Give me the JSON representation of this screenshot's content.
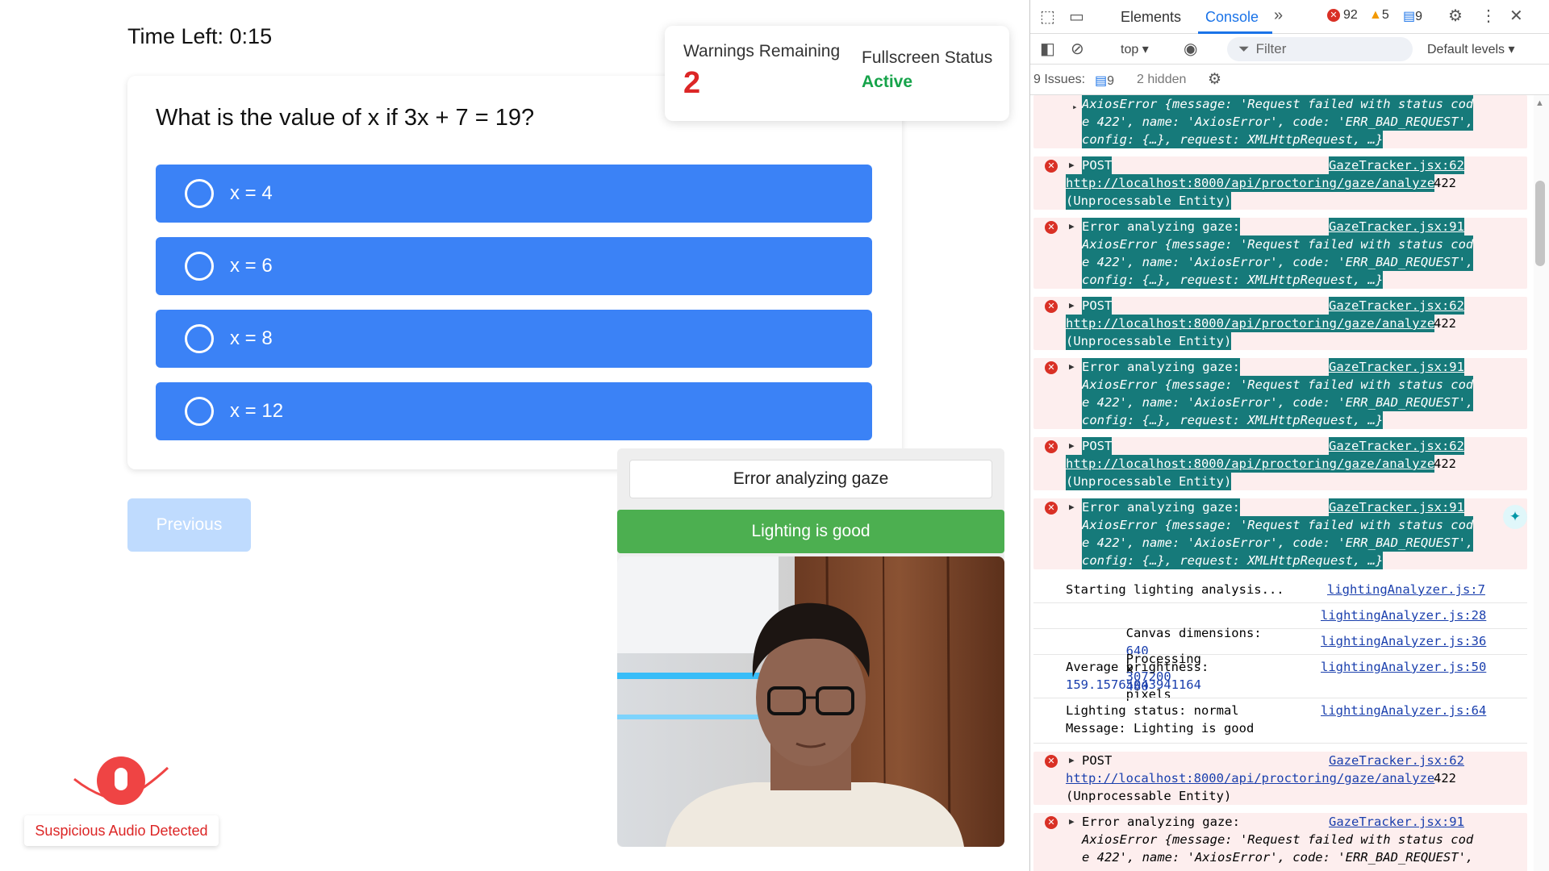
{
  "exam": {
    "timer": "Time Left: 0:15",
    "question": "What is the value of x if 3x + 7 = 19?",
    "options": [
      "x = 4",
      "x = 6",
      "x = 8",
      "x = 12"
    ],
    "previous_label": "Previous",
    "warnings_label": "Warnings Remaining",
    "warnings_value": "2",
    "fullscreen_label": "Fullscreen Status",
    "fullscreen_value": "Active",
    "gaze_status": "Error analyzing gaze",
    "lighting_status": "Lighting is good",
    "audio_alert": "Suspicious Audio Detected"
  },
  "devtools": {
    "tabs": [
      "Elements",
      "Console"
    ],
    "active_tab": "Console",
    "error_count": "92",
    "warning_count": "5",
    "info_count": "9",
    "context": "top",
    "filter_placeholder": "Filter",
    "levels": "Default levels",
    "issues_label": "9 Issues:",
    "issues_count": "9",
    "hidden_label": "2 hidden",
    "log": {
      "post": "POST",
      "gaze_url": "http://localhost:8000/api/proctoring/gaze/analyze",
      "status_code": "422",
      "status_text": "(Unprocessable Entity)",
      "gaze_error": "Error analyzing gaze:",
      "axios_a": "AxiosError {message: 'Request failed with status cod",
      "axios_b": "e 422', name: 'AxiosError', code: 'ERR_BAD_REQUEST',",
      "axios_c": "config: {…}, request: XMLHttpRequest, …}",
      "src_post": "GazeTracker.jsx:62",
      "src_err": "GazeTracker.jsx:91",
      "lighting_1": "Starting lighting analysis...",
      "lighting_1_src": "lightingAnalyzer.js:7",
      "lighting_2_text": "Canvas dimensions:",
      "lighting_2_w": "640",
      "lighting_2_x": "x",
      "lighting_2_h": "480",
      "lighting_2_src": "lightingAnalyzer.js:28",
      "lighting_3_text": "Processing",
      "lighting_3_num": "307200",
      "lighting_3_tail": "pixels",
      "lighting_3_src": "lightingAnalyzer.js:36",
      "lighting_4_text": "Average brightness:",
      "lighting_4_num": "159.15765043941164",
      "lighting_4_src": "lightingAnalyzer.js:50",
      "lighting_5_a": "Lighting status: normal",
      "lighting_5_b": "Message: Lighting is good",
      "lighting_5_src": "lightingAnalyzer.js:64"
    }
  },
  "colors": {
    "option_blue": "#3b82f6",
    "warning_red": "#dc2626",
    "active_green": "#16a34a",
    "lighting_green": "#4caf50",
    "devtools_accent": "#1a73e8",
    "console_error_bg": "#fdeeee",
    "highlight_teal": "#167a7a"
  }
}
